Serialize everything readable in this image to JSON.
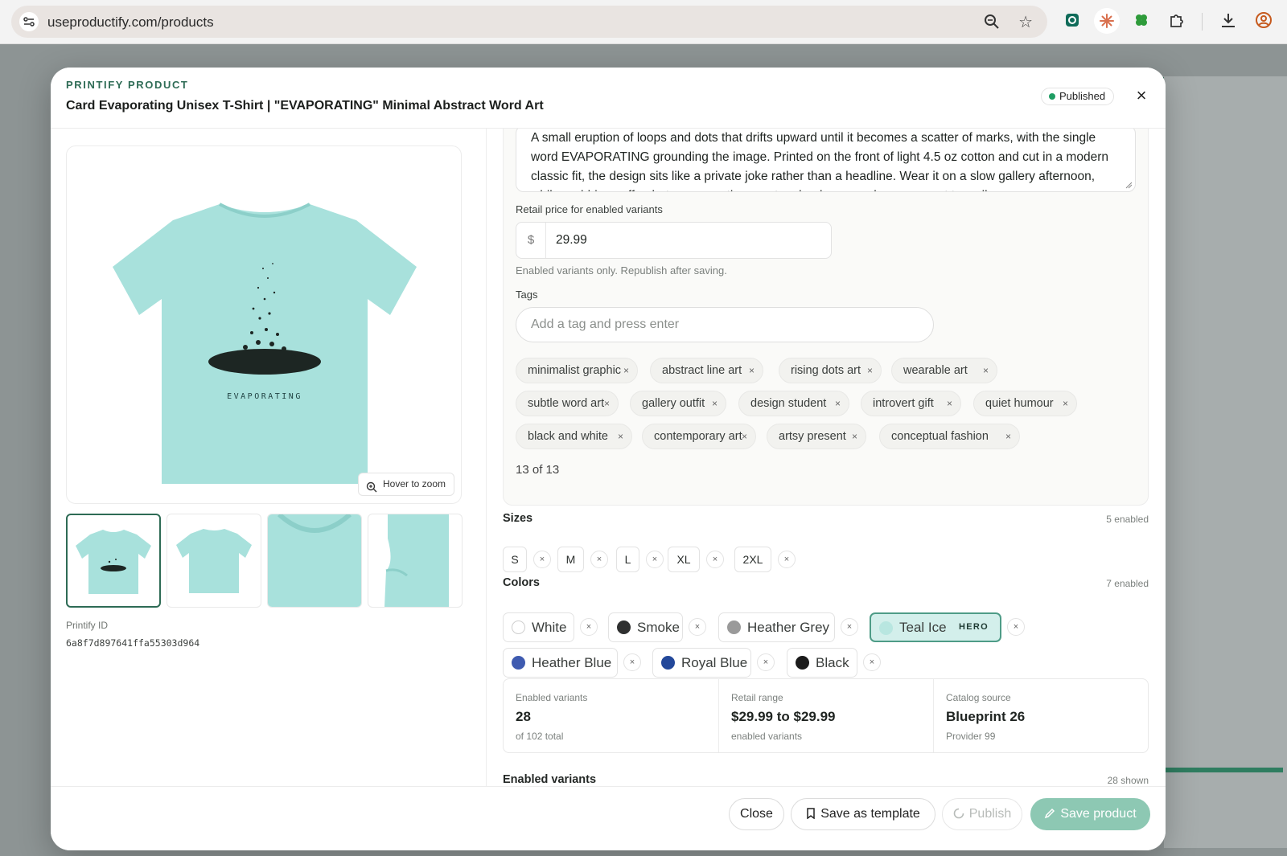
{
  "browser": {
    "url": "useproductify.com/products"
  },
  "modal": {
    "kicker": "PRINTIFY PRODUCT",
    "title": "Card Evaporating Unisex T-Shirt | \"EVAPORATING\" Minimal Abstract Word Art",
    "status": "Published",
    "close_glyph": "×"
  },
  "gallery": {
    "zoom_hint": "Hover to zoom",
    "shirt_word": "EVAPORATING",
    "shirt_color": "#a8e1dc",
    "printify_id_label": "Printify ID",
    "printify_id": "6a8f7d897641ffa55303d964"
  },
  "details": {
    "description": "A small eruption of loops and dots that drifts upward until it becomes a scatter of marks, with the single word EVAPORATING grounding the image. Printed on the front of light 4.5 oz cotton and cut in a modern classic fit, the design sits like a private joke rather than a headline. Wear it on a slow gallery afternoon, while grabbing coffee between meetings, or to a book group when you want to smile.",
    "price_label": "Retail price for enabled variants",
    "currency": "$",
    "price": "29.99",
    "price_hint": "Enabled variants only. Republish after saving.",
    "tags_label": "Tags",
    "tag_placeholder": "Add a tag and press enter",
    "tags": [
      "minimalist graphic",
      "abstract line art",
      "rising dots art",
      "wearable art",
      "subtle word art",
      "gallery outfit",
      "design student",
      "introvert gift",
      "quiet humour",
      "black and white",
      "contemporary art",
      "artsy present",
      "conceptual fashion"
    ],
    "tag_count": "13 of 13"
  },
  "sizes": {
    "title": "Sizes",
    "meta": "5 enabled",
    "items": [
      "S",
      "M",
      "L",
      "XL",
      "2XL"
    ]
  },
  "colors": {
    "title": "Colors",
    "meta": "7 enabled",
    "hero_label": "HERO",
    "items": [
      {
        "name": "White",
        "hex": "#ffffff"
      },
      {
        "name": "Smoke",
        "hex": "#2f3030"
      },
      {
        "name": "Heather Grey",
        "hex": "#9a9a9a"
      },
      {
        "name": "Teal Ice",
        "hex": "#b8e6e0"
      },
      {
        "name": "Heather Blue",
        "hex": "#3f5bb0"
      },
      {
        "name": "Royal Blue",
        "hex": "#23489a"
      },
      {
        "name": "Black",
        "hex": "#1b1b1b"
      }
    ]
  },
  "stats": [
    {
      "label": "Enabled variants",
      "value": "28",
      "sub": "of 102 total"
    },
    {
      "label": "Retail range",
      "value": "$29.99 to $29.99",
      "sub": "enabled variants"
    },
    {
      "label": "Catalog source",
      "value": "Blueprint 26",
      "sub": "Provider 99"
    }
  ],
  "variants": {
    "title": "Enabled variants",
    "meta": "28 shown"
  },
  "footer": {
    "close": "Close",
    "save_template": "Save as template",
    "publish": "Publish",
    "save_product": "Save product"
  }
}
